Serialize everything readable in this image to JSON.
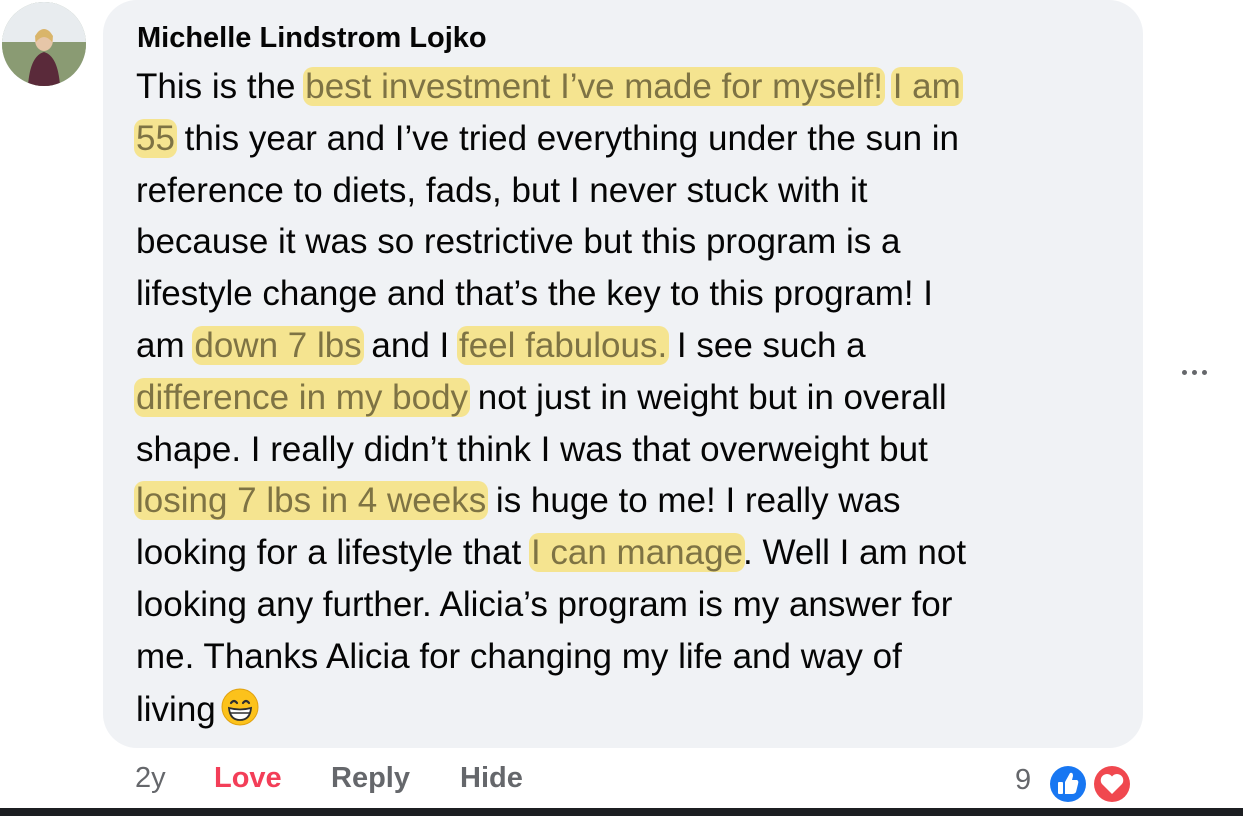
{
  "comment": {
    "author": "Michelle Lindstrom Lojko",
    "lines": [
      [
        {
          "t": "This is the "
        },
        {
          "t": "best investment I’ve made for myself!",
          "hl": true
        },
        {
          "t": " "
        },
        {
          "t": "I am",
          "hl": true
        }
      ],
      [
        {
          "t": "55",
          "hl": true
        },
        {
          "t": " this year and I’ve tried everything under the sun in"
        }
      ],
      [
        {
          "t": "reference to diets, fads, but I never stuck with it"
        }
      ],
      [
        {
          "t": "because it was so restrictive but this program is a"
        }
      ],
      [
        {
          "t": "lifestyle change and that’s the key to this program! I"
        }
      ],
      [
        {
          "t": "am "
        },
        {
          "t": "down 7 lbs",
          "hl": true
        },
        {
          "t": " and I "
        },
        {
          "t": "feel fabulous.",
          "hl": true
        },
        {
          "t": " I see such a"
        }
      ],
      [
        {
          "t": "difference in my body",
          "hl": true
        },
        {
          "t": " not just in weight but in overall"
        }
      ],
      [
        {
          "t": "shape. I really didn’t think I was that overweight but"
        }
      ],
      [
        {
          "t": "losing 7 lbs in 4 weeks",
          "hl": true
        },
        {
          "t": " is huge to me! I really was"
        }
      ],
      [
        {
          "t": "looking for a lifestyle that "
        },
        {
          "t": "I can manage",
          "hl": true
        },
        {
          "t": ". Well I am not"
        }
      ],
      [
        {
          "t": "looking any further. Alicia’s program is my answer for"
        }
      ],
      [
        {
          "t": "me. Thanks Alicia for changing my life and way of"
        }
      ],
      [
        {
          "t": "living"
        }
      ]
    ],
    "emoji": "grinning-face-with-smiling-eyes",
    "highlight_color": "#f8da4c"
  },
  "actions": {
    "time": "2y",
    "love": "Love",
    "reply": "Reply",
    "hide": "Hide",
    "love_color": "#f33e58"
  },
  "reactions": {
    "count": "9",
    "icons": [
      "like-icon",
      "heart-icon"
    ]
  },
  "more_menu_icon": "ellipsis-icon"
}
